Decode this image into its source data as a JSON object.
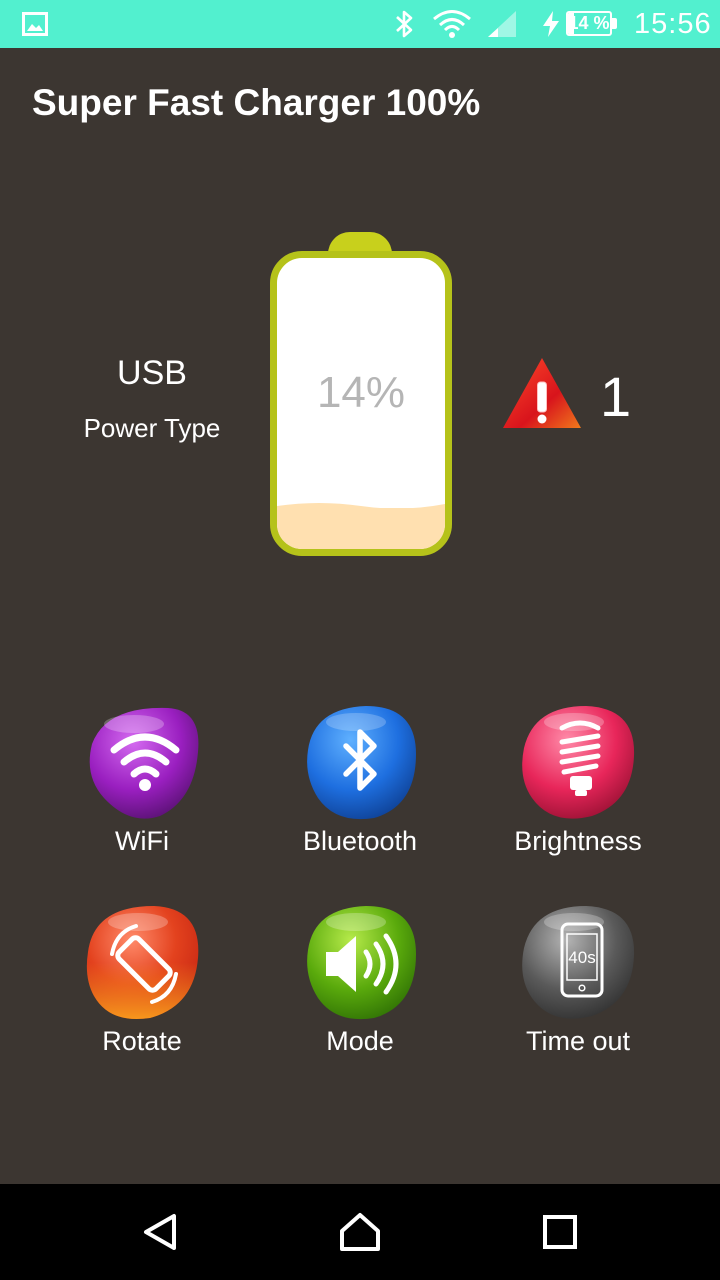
{
  "status_bar": {
    "battery_percent": "14 %",
    "battery_level": 0.14,
    "time": "15:56",
    "icons": [
      "image-notification-icon",
      "bluetooth-icon",
      "wifi-icon",
      "cellular-signal-icon",
      "charging-bolt-icon",
      "battery-icon"
    ]
  },
  "app": {
    "title": "Super Fast Charger 100%"
  },
  "power": {
    "value": "USB",
    "label": "Power Type"
  },
  "battery": {
    "level_text": "14%",
    "level": 0.14
  },
  "alerts": {
    "icon": "warning-icon",
    "count": "1"
  },
  "toggles": [
    {
      "label": "WiFi",
      "icon": "wifi-icon",
      "color": "#9a1fc0"
    },
    {
      "label": "Bluetooth",
      "icon": "bluetooth-icon",
      "color": "#1e6fe0"
    },
    {
      "label": "Brightness",
      "icon": "bulb-icon",
      "color": "#e8265a"
    },
    {
      "label": "Rotate",
      "icon": "rotate-icon",
      "color": "#e3421e"
    },
    {
      "label": "Mode",
      "icon": "speaker-icon",
      "color": "#5aaa0c"
    },
    {
      "label": "Time out",
      "icon": "timeout-icon",
      "color": "#5a5a5a",
      "timeout_text": "40s"
    }
  ],
  "nav_bar": {
    "buttons": [
      "back-icon",
      "home-icon",
      "recents-icon"
    ]
  }
}
